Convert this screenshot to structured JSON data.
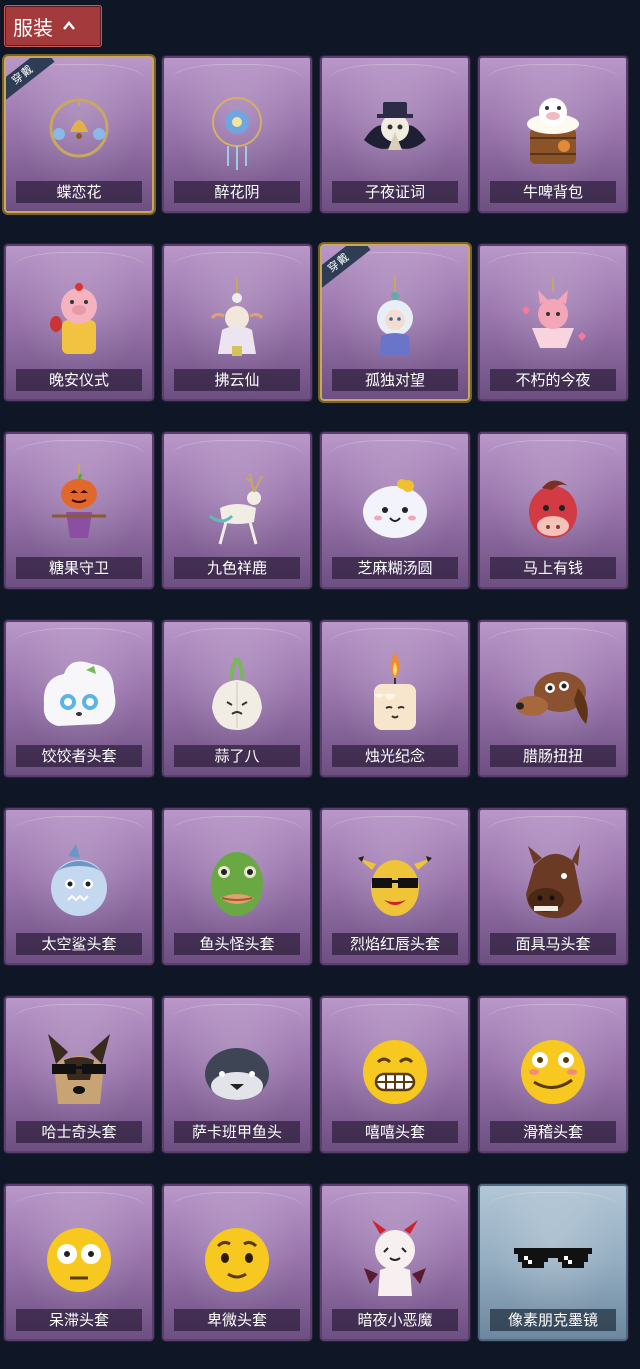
{
  "header": {
    "label": "服装"
  },
  "badge_text": "穿戴",
  "items": [
    {
      "name": "蝶恋花",
      "worn": true,
      "icon": "bell-ornament-icon",
      "theme": "purple"
    },
    {
      "name": "醉花阴",
      "worn": false,
      "icon": "flower-dreamcatcher-icon",
      "theme": "purple"
    },
    {
      "name": "子夜证词",
      "worn": false,
      "icon": "plague-doctor-icon",
      "theme": "purple"
    },
    {
      "name": "牛啤背包",
      "worn": false,
      "icon": "cow-beer-barrel-icon",
      "theme": "purple"
    },
    {
      "name": "晚安仪式",
      "worn": false,
      "icon": "pig-doll-icon",
      "theme": "purple"
    },
    {
      "name": "拂云仙",
      "worn": false,
      "icon": "cloud-fairy-icon",
      "theme": "purple"
    },
    {
      "name": "孤独对望",
      "worn": true,
      "icon": "doll-charm-icon",
      "theme": "purple"
    },
    {
      "name": "不朽的今夜",
      "worn": false,
      "icon": "fox-bowl-icon",
      "theme": "purple"
    },
    {
      "name": "糖果守卫",
      "worn": false,
      "icon": "pumpkin-scarecrow-icon",
      "theme": "purple"
    },
    {
      "name": "九色祥鹿",
      "worn": false,
      "icon": "deer-icon",
      "theme": "purple"
    },
    {
      "name": "芝麻糊汤圆",
      "worn": false,
      "icon": "dumpling-icon",
      "theme": "purple"
    },
    {
      "name": "马上有钱",
      "worn": false,
      "icon": "red-horse-icon",
      "theme": "purple"
    },
    {
      "name": "饺饺者头套",
      "worn": false,
      "icon": "dumpling-head-icon",
      "theme": "purple"
    },
    {
      "name": "蒜了八",
      "worn": false,
      "icon": "garlic-icon",
      "theme": "purple"
    },
    {
      "name": "烛光纪念",
      "worn": false,
      "icon": "candle-icon",
      "theme": "purple"
    },
    {
      "name": "腊肠扭扭",
      "worn": false,
      "icon": "dachshund-icon",
      "theme": "purple"
    },
    {
      "name": "太空鲨头套",
      "worn": false,
      "icon": "shark-head-icon",
      "theme": "purple"
    },
    {
      "name": "鱼头怪头套",
      "worn": false,
      "icon": "fish-head-icon",
      "theme": "purple"
    },
    {
      "name": "烈焰红唇头套",
      "worn": false,
      "icon": "pikachu-head-icon",
      "theme": "purple"
    },
    {
      "name": "面具马头套",
      "worn": false,
      "icon": "horse-mask-icon",
      "theme": "purple"
    },
    {
      "name": "哈士奇头套",
      "worn": false,
      "icon": "husky-head-icon",
      "theme": "purple"
    },
    {
      "name": "萨卡班甲鱼头",
      "worn": false,
      "icon": "fish-head-round-icon",
      "theme": "purple"
    },
    {
      "name": "嘻嘻头套",
      "worn": false,
      "icon": "grin-emoji-icon",
      "theme": "purple"
    },
    {
      "name": "滑稽头套",
      "worn": false,
      "icon": "funny-emoji-icon",
      "theme": "purple"
    },
    {
      "name": "呆滞头套",
      "worn": false,
      "icon": "stunned-emoji-icon",
      "theme": "purple"
    },
    {
      "name": "卑微头套",
      "worn": false,
      "icon": "humble-emoji-icon",
      "theme": "purple"
    },
    {
      "name": "暗夜小恶魔",
      "worn": false,
      "icon": "little-devil-icon",
      "theme": "purple"
    },
    {
      "name": "像素朋克墨镜",
      "worn": false,
      "icon": "pixel-sunglasses-icon",
      "theme": "blue"
    }
  ]
}
